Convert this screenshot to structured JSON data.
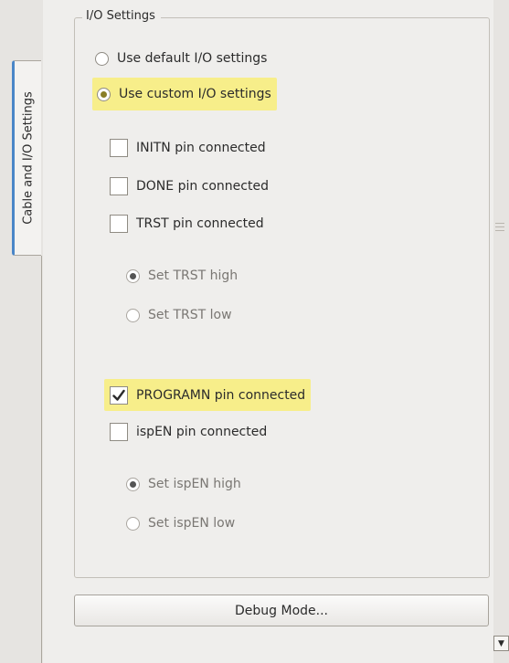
{
  "sidebar": {
    "tab_label": "Cable and I/O Settings"
  },
  "io_settings": {
    "title": "I/O Settings",
    "mode_options": [
      {
        "label": "Use default I/O settings",
        "selected": false,
        "highlighted": false
      },
      {
        "label": "Use custom I/O settings",
        "selected": true,
        "highlighted": true
      }
    ],
    "initn": {
      "label": "INITN pin connected",
      "checked": false
    },
    "done": {
      "label": "DONE pin connected",
      "checked": false
    },
    "trst": {
      "label": "TRST pin connected",
      "checked": false,
      "options": [
        {
          "label": "Set TRST high",
          "selected": true
        },
        {
          "label": "Set TRST low",
          "selected": false
        }
      ]
    },
    "programn": {
      "label": "PROGRAMN pin connected",
      "checked": true,
      "highlighted": true
    },
    "ispen": {
      "label": "ispEN pin connected",
      "checked": false,
      "options": [
        {
          "label": "Set ispEN high",
          "selected": true
        },
        {
          "label": "Set ispEN low",
          "selected": false
        }
      ]
    }
  },
  "debug_button": {
    "label": "Debug Mode..."
  },
  "colors": {
    "highlight": "#f7ee8a",
    "tab_accent": "#4a86c8"
  },
  "icons": {
    "scroll_down": "chevron-down-icon",
    "check": "checkmark-icon"
  }
}
